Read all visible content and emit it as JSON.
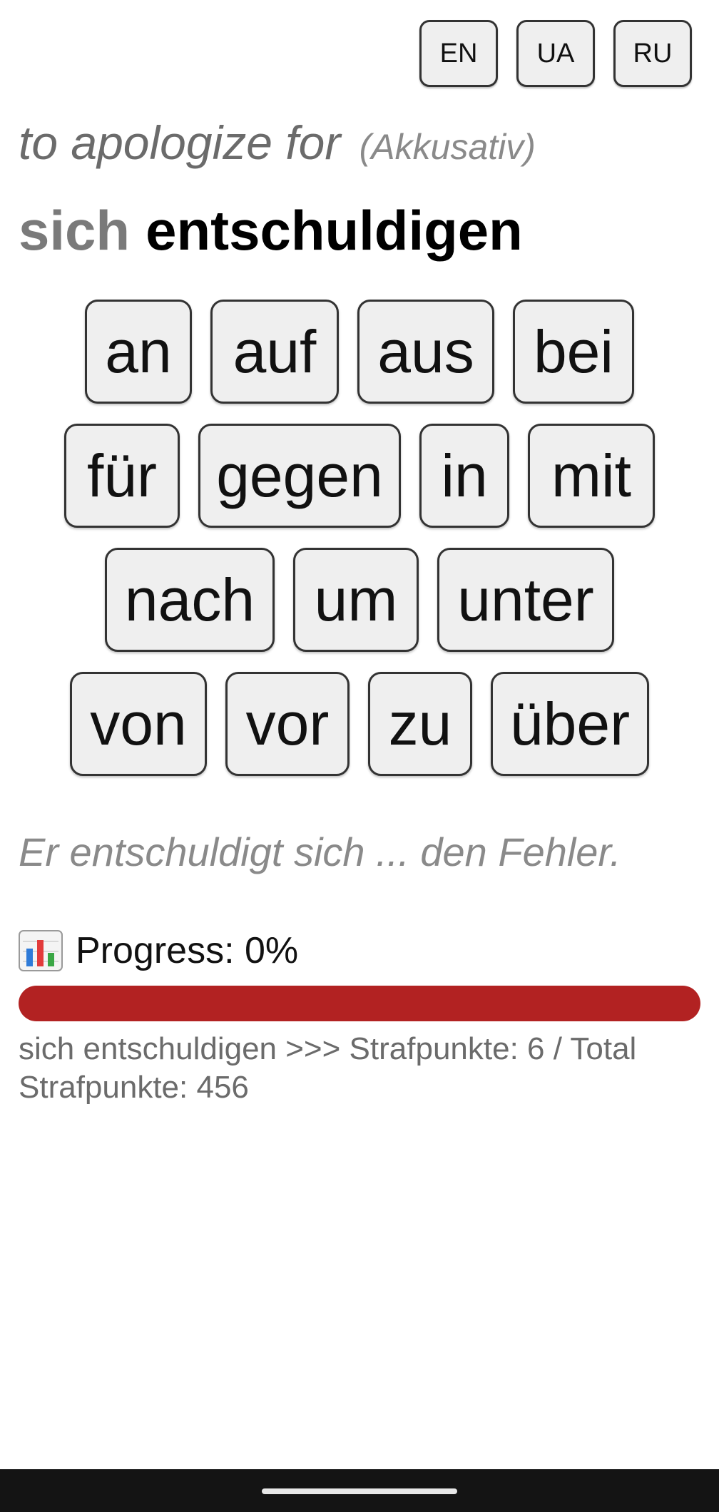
{
  "languages": [
    {
      "label": "EN"
    },
    {
      "label": "UA"
    },
    {
      "label": "RU"
    }
  ],
  "translation": {
    "text": "to apologize for",
    "case": "(Akkusativ)"
  },
  "verb": {
    "reflexive": "sich",
    "infinitive": "entschuldigen"
  },
  "prepositions": [
    [
      "an",
      "auf",
      "aus",
      "bei"
    ],
    [
      "für",
      "gegen",
      "in",
      "mit"
    ],
    [
      "nach",
      "um",
      "unter"
    ],
    [
      "von",
      "vor",
      "zu",
      "über"
    ]
  ],
  "sentence": "Er entschuldigt sich ... den Fehler.",
  "progress": {
    "label": "Progress: 0%",
    "value_percent": 0,
    "track_color": "#b22222",
    "fill_color": "#4caf50",
    "icon": "bar-chart-icon"
  },
  "penalty_text": "sich entschuldigen >>> Strafpunkte: 6 / Total Strafpunkte: 456"
}
